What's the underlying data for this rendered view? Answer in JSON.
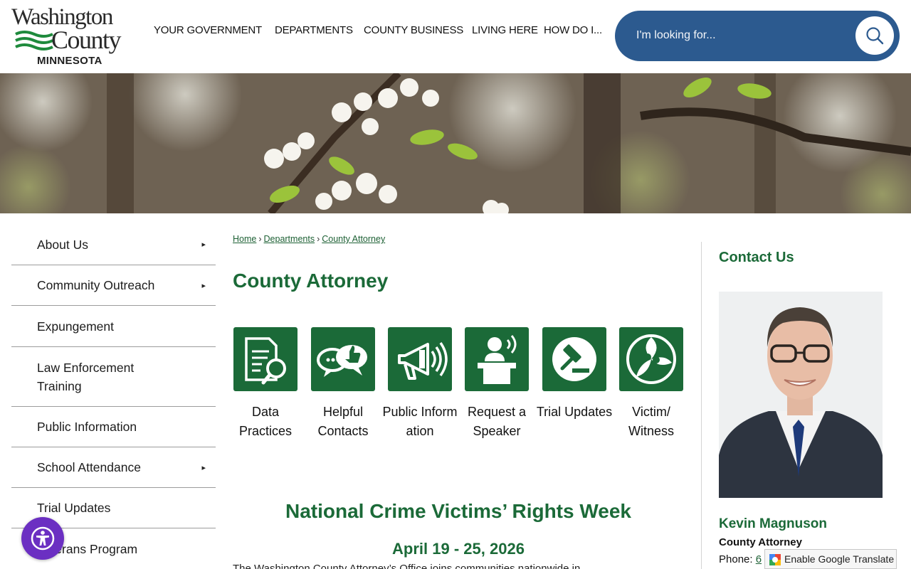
{
  "logo": {
    "line1": "Washington",
    "line2": "County",
    "line3": "MINNESOTA"
  },
  "nav": [
    {
      "label": "YOUR GOVERNMENT"
    },
    {
      "label": "DEPARTMENTS"
    },
    {
      "label": "COUNTY BUSINESS"
    },
    {
      "label": "LIVING HERE"
    },
    {
      "label": "HOW DO I..."
    }
  ],
  "search": {
    "placeholder": "I'm looking for...",
    "icon": "search-icon"
  },
  "sidebar": {
    "items": [
      {
        "label": "About Us",
        "has_submenu": true
      },
      {
        "label": "Community Outreach",
        "has_submenu": true
      },
      {
        "label": "Expungement",
        "has_submenu": false
      },
      {
        "label": "Law Enforcement Training",
        "has_submenu": false
      },
      {
        "label": "Public Information",
        "has_submenu": false
      },
      {
        "label": "School Attendance",
        "has_submenu": true
      },
      {
        "label": "Trial Updates",
        "has_submenu": false
      },
      {
        "label": "Veterans Program",
        "has_submenu": false
      }
    ],
    "submenu_arrow": "▸"
  },
  "breadcrumb": {
    "items": [
      "Home",
      "Departments",
      "County Attorney"
    ],
    "separator": "›"
  },
  "page_title": "County Attorney",
  "tiles": [
    {
      "label": "Data Practices",
      "icon": "document-search-icon"
    },
    {
      "label": "Helpful Contacts",
      "icon": "chat-thumbs-up-icon"
    },
    {
      "label": "Public Information",
      "icon": "megaphone-icon"
    },
    {
      "label": "Request a Speaker",
      "icon": "speaker-podium-icon"
    },
    {
      "label": "Trial Updates",
      "icon": "gavel-icon"
    },
    {
      "label": "Victim/ Witness",
      "icon": "people-circle-icon"
    }
  ],
  "section": {
    "title": "National Crime Victims’ Rights Week",
    "date": "April 19 - 25, 2026",
    "intro": "The Washington County Attorney’s Office joins communities nationwide in"
  },
  "contact": {
    "title": "Contact Us",
    "name": "Kevin Magnuson",
    "role": "County Attorney",
    "phone_label": "Phone: ",
    "phone_value": "6"
  },
  "translate": {
    "label": "Enable Google Translate"
  },
  "colors": {
    "brand_green": "#1b6a38",
    "search_blue": "#2c5a8f",
    "accessibility_purple": "#6b2fc2"
  }
}
